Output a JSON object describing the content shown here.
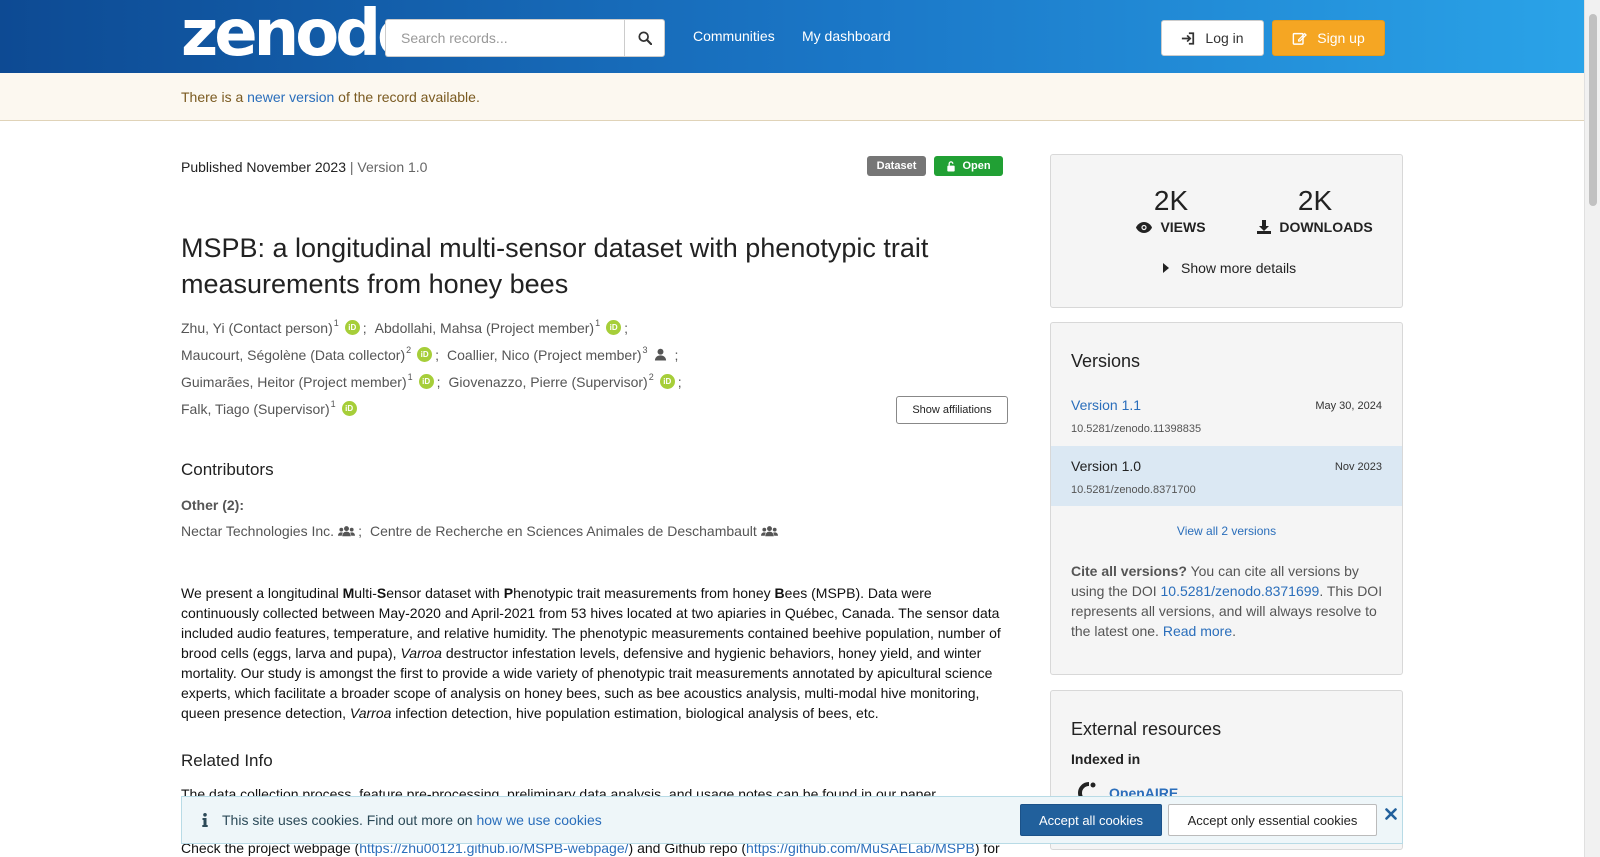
{
  "header": {
    "logo_text": "zenodo",
    "search_placeholder": "Search records...",
    "nav": {
      "communities": "Communities",
      "dashboard": "My dashboard"
    },
    "login_label": "Log in",
    "signup_label": "Sign up"
  },
  "notice": {
    "prefix": "There is a ",
    "link": "newer version",
    "suffix": " of the record available."
  },
  "record": {
    "published": "Published November 2023",
    "pipe": " | ",
    "version": "Version 1.0",
    "badge_type": "Dataset",
    "badge_access": "Open",
    "title": "MSPB: a longitudinal multi-sensor dataset with phenotypic trait measurements from honey bees",
    "creators": [
      {
        "name": "Zhu, Yi (Contact person)",
        "aff": "1",
        "orcid": "iD"
      },
      {
        "name": "Abdollahi, Mahsa (Project member)",
        "aff": "1",
        "orcid": "iD"
      },
      {
        "name": "Maucourt, Ségolène (Data collector)",
        "aff": "2",
        "orcid": "iD"
      },
      {
        "name": "Coallier, Nico (Project member)",
        "aff": "3"
      },
      {
        "name": "Guimarães, Heitor (Project member)",
        "aff": "1",
        "orcid": "iD"
      },
      {
        "name": "Giovenazzo, Pierre (Supervisor)",
        "aff": "2",
        "orcid": "iD"
      },
      {
        "name": "Falk, Tiago (Supervisor)",
        "aff": "1",
        "orcid": "iD"
      }
    ],
    "separator": ";",
    "show_affiliations": "Show affiliations",
    "contributors_heading": "Contributors",
    "contributors_other_label": "Other (2):",
    "contributors": [
      "Nectar Technologies Inc.",
      "Centre de Recherche en Sciences Animales de Deschambault"
    ],
    "description": {
      "p1": "We present a longitudinal ",
      "b1": "M",
      "p2": "ulti-",
      "b2": "S",
      "p3": "ensor dataset with ",
      "b3": "P",
      "p4": "henotypic trait measurements from honey ",
      "b4": "B",
      "p5": "ees (MSPB). Data were continuously collected between May-2020 and April-2021 from 53 hives located at two apiaries in Québec, Canada. The sensor data included audio features, temperature, and relative humidity. The phenotypic measurements contained beehive population, number of brood cells (eggs, larva and pupa), ",
      "i1": "Varroa",
      "p6": " destructor infestation levels, defensive and hygienic behaviors, honey yield, and winter mortality. Our study is amongst the first to provide a wide variety of phenotypic trait measurements annotated by apicultural science experts, which facilitate a broader scope of analysis on honey bees, such as bee acoustics analysis, multi-modal hive monitoring, queen presence detection, ",
      "i2": "Varroa",
      "p7": " infection detection, hive population estimation, biological analysis of bees, etc."
    },
    "related_heading": "Related Info",
    "related_text": "The data collection process, feature pre-processing, preliminary data analysis, and usage notes can be found in our paper",
    "related2_prefix": "Check the project webpage (",
    "related2_link1": "https://zhu00121.github.io/MSPB-webpage/",
    "related2_mid": ") and Github repo (",
    "related2_link2": "https://github.com/MuSAELab/MSPB",
    "related2_suffix": ") for"
  },
  "sidebar": {
    "views_count": "2K",
    "views_label": "VIEWS",
    "downloads_count": "2K",
    "downloads_label": "DOWNLOADS",
    "more_details": "Show more details",
    "versions_title": "Versions",
    "versions": [
      {
        "name": "Version 1.1",
        "date": "May 30, 2024",
        "doi": "10.5281/zenodo.11398835"
      },
      {
        "name": "Version 1.0",
        "date": "Nov 2023",
        "doi": "10.5281/zenodo.8371700"
      }
    ],
    "view_all": "View all 2 versions",
    "cite_bold": "Cite all versions?",
    "cite_p1": " You can cite all versions by using the DOI ",
    "cite_doi": "10.5281/zenodo.8371699",
    "cite_p2": ". This DOI represents all versions, and will always resolve to the latest one. ",
    "cite_read_more": "Read more",
    "cite_end": ".",
    "external_title": "External resources",
    "indexed_in": "Indexed in",
    "openaire": "OpenAIRE"
  },
  "cookie": {
    "text": "This site uses cookies. Find out more on ",
    "link": "how we use cookies",
    "accept_all": "Accept all cookies",
    "accept_essential": "Accept only essential cookies"
  },
  "colors": {
    "header_start": "#0d4a93",
    "header_end": "#2aa3e8",
    "signup": "#f5a623",
    "open_badge": "#21a034",
    "orcid": "#a6ce39",
    "link": "#2a6ebb"
  },
  "icons": {
    "search": "search-icon",
    "login": "sign-in-icon",
    "signup": "edit-icon",
    "lock_open": "unlock-icon",
    "views": "eye-icon",
    "downloads": "download-icon",
    "caret": "caret-right-icon",
    "info": "info-icon",
    "close": "close-icon"
  }
}
